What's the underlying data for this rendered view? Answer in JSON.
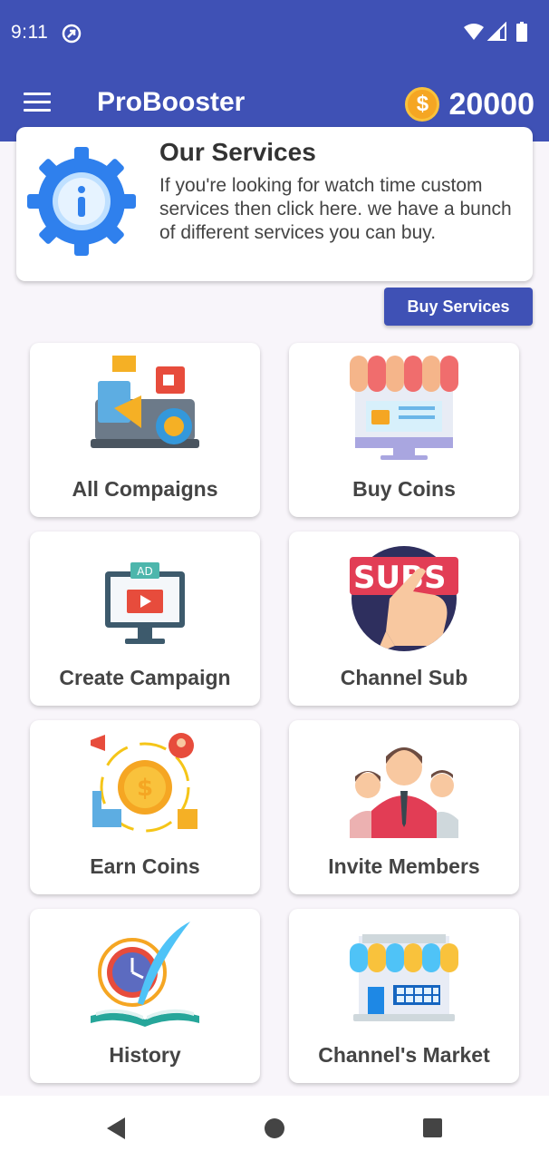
{
  "status": {
    "time": "9:11"
  },
  "appbar": {
    "title": "ProBooster",
    "coin_symbol": "$",
    "coins": "20000"
  },
  "services": {
    "title": "Our Services",
    "description": "If you're looking for watch time custom services then click here. we have a bunch of different services you can buy.",
    "button": "Buy Services"
  },
  "tiles": [
    {
      "label": "All Compaigns",
      "icon": "campaigns-icon"
    },
    {
      "label": "Buy Coins",
      "icon": "shop-icon"
    },
    {
      "label": "Create Campaign",
      "icon": "ad-monitor-icon"
    },
    {
      "label": "Channel Sub",
      "icon": "subscribe-icon",
      "icon_text": "SUBS"
    },
    {
      "label": "Earn Coins",
      "icon": "coin-earn-icon"
    },
    {
      "label": "Invite Members",
      "icon": "members-icon"
    },
    {
      "label": "History",
      "icon": "history-icon"
    },
    {
      "label": "Channel's Market",
      "icon": "market-icon"
    }
  ],
  "colors": {
    "primary": "#3f51b5",
    "background": "#f8f5fa",
    "coin": "#f5a623"
  }
}
